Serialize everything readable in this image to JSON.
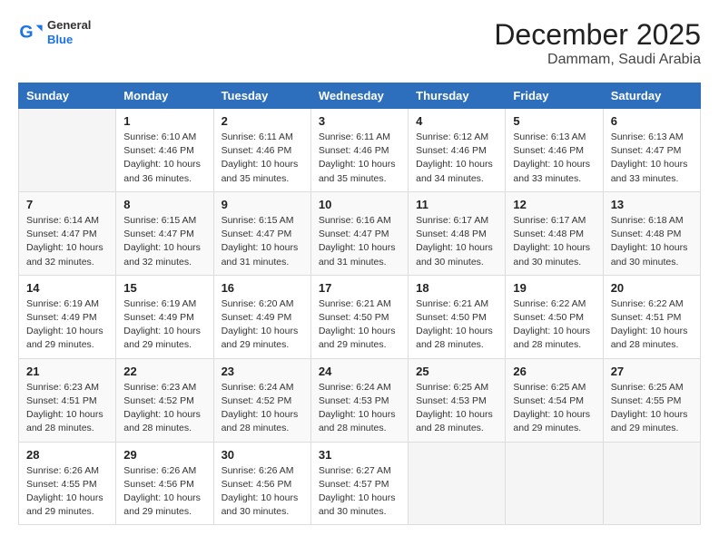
{
  "header": {
    "logo_general": "General",
    "logo_blue": "Blue",
    "month_year": "December 2025",
    "location": "Dammam, Saudi Arabia"
  },
  "days_of_week": [
    "Sunday",
    "Monday",
    "Tuesday",
    "Wednesday",
    "Thursday",
    "Friday",
    "Saturday"
  ],
  "weeks": [
    [
      {
        "day": "",
        "info": ""
      },
      {
        "day": "1",
        "info": "Sunrise: 6:10 AM\nSunset: 4:46 PM\nDaylight: 10 hours\nand 36 minutes."
      },
      {
        "day": "2",
        "info": "Sunrise: 6:11 AM\nSunset: 4:46 PM\nDaylight: 10 hours\nand 35 minutes."
      },
      {
        "day": "3",
        "info": "Sunrise: 6:11 AM\nSunset: 4:46 PM\nDaylight: 10 hours\nand 35 minutes."
      },
      {
        "day": "4",
        "info": "Sunrise: 6:12 AM\nSunset: 4:46 PM\nDaylight: 10 hours\nand 34 minutes."
      },
      {
        "day": "5",
        "info": "Sunrise: 6:13 AM\nSunset: 4:46 PM\nDaylight: 10 hours\nand 33 minutes."
      },
      {
        "day": "6",
        "info": "Sunrise: 6:13 AM\nSunset: 4:47 PM\nDaylight: 10 hours\nand 33 minutes."
      }
    ],
    [
      {
        "day": "7",
        "info": "Sunrise: 6:14 AM\nSunset: 4:47 PM\nDaylight: 10 hours\nand 32 minutes."
      },
      {
        "day": "8",
        "info": "Sunrise: 6:15 AM\nSunset: 4:47 PM\nDaylight: 10 hours\nand 32 minutes."
      },
      {
        "day": "9",
        "info": "Sunrise: 6:15 AM\nSunset: 4:47 PM\nDaylight: 10 hours\nand 31 minutes."
      },
      {
        "day": "10",
        "info": "Sunrise: 6:16 AM\nSunset: 4:47 PM\nDaylight: 10 hours\nand 31 minutes."
      },
      {
        "day": "11",
        "info": "Sunrise: 6:17 AM\nSunset: 4:48 PM\nDaylight: 10 hours\nand 30 minutes."
      },
      {
        "day": "12",
        "info": "Sunrise: 6:17 AM\nSunset: 4:48 PM\nDaylight: 10 hours\nand 30 minutes."
      },
      {
        "day": "13",
        "info": "Sunrise: 6:18 AM\nSunset: 4:48 PM\nDaylight: 10 hours\nand 30 minutes."
      }
    ],
    [
      {
        "day": "14",
        "info": "Sunrise: 6:19 AM\nSunset: 4:49 PM\nDaylight: 10 hours\nand 29 minutes."
      },
      {
        "day": "15",
        "info": "Sunrise: 6:19 AM\nSunset: 4:49 PM\nDaylight: 10 hours\nand 29 minutes."
      },
      {
        "day": "16",
        "info": "Sunrise: 6:20 AM\nSunset: 4:49 PM\nDaylight: 10 hours\nand 29 minutes."
      },
      {
        "day": "17",
        "info": "Sunrise: 6:21 AM\nSunset: 4:50 PM\nDaylight: 10 hours\nand 29 minutes."
      },
      {
        "day": "18",
        "info": "Sunrise: 6:21 AM\nSunset: 4:50 PM\nDaylight: 10 hours\nand 28 minutes."
      },
      {
        "day": "19",
        "info": "Sunrise: 6:22 AM\nSunset: 4:50 PM\nDaylight: 10 hours\nand 28 minutes."
      },
      {
        "day": "20",
        "info": "Sunrise: 6:22 AM\nSunset: 4:51 PM\nDaylight: 10 hours\nand 28 minutes."
      }
    ],
    [
      {
        "day": "21",
        "info": "Sunrise: 6:23 AM\nSunset: 4:51 PM\nDaylight: 10 hours\nand 28 minutes."
      },
      {
        "day": "22",
        "info": "Sunrise: 6:23 AM\nSunset: 4:52 PM\nDaylight: 10 hours\nand 28 minutes."
      },
      {
        "day": "23",
        "info": "Sunrise: 6:24 AM\nSunset: 4:52 PM\nDaylight: 10 hours\nand 28 minutes."
      },
      {
        "day": "24",
        "info": "Sunrise: 6:24 AM\nSunset: 4:53 PM\nDaylight: 10 hours\nand 28 minutes."
      },
      {
        "day": "25",
        "info": "Sunrise: 6:25 AM\nSunset: 4:53 PM\nDaylight: 10 hours\nand 28 minutes."
      },
      {
        "day": "26",
        "info": "Sunrise: 6:25 AM\nSunset: 4:54 PM\nDaylight: 10 hours\nand 29 minutes."
      },
      {
        "day": "27",
        "info": "Sunrise: 6:25 AM\nSunset: 4:55 PM\nDaylight: 10 hours\nand 29 minutes."
      }
    ],
    [
      {
        "day": "28",
        "info": "Sunrise: 6:26 AM\nSunset: 4:55 PM\nDaylight: 10 hours\nand 29 minutes."
      },
      {
        "day": "29",
        "info": "Sunrise: 6:26 AM\nSunset: 4:56 PM\nDaylight: 10 hours\nand 29 minutes."
      },
      {
        "day": "30",
        "info": "Sunrise: 6:26 AM\nSunset: 4:56 PM\nDaylight: 10 hours\nand 30 minutes."
      },
      {
        "day": "31",
        "info": "Sunrise: 6:27 AM\nSunset: 4:57 PM\nDaylight: 10 hours\nand 30 minutes."
      },
      {
        "day": "",
        "info": ""
      },
      {
        "day": "",
        "info": ""
      },
      {
        "day": "",
        "info": ""
      }
    ]
  ]
}
